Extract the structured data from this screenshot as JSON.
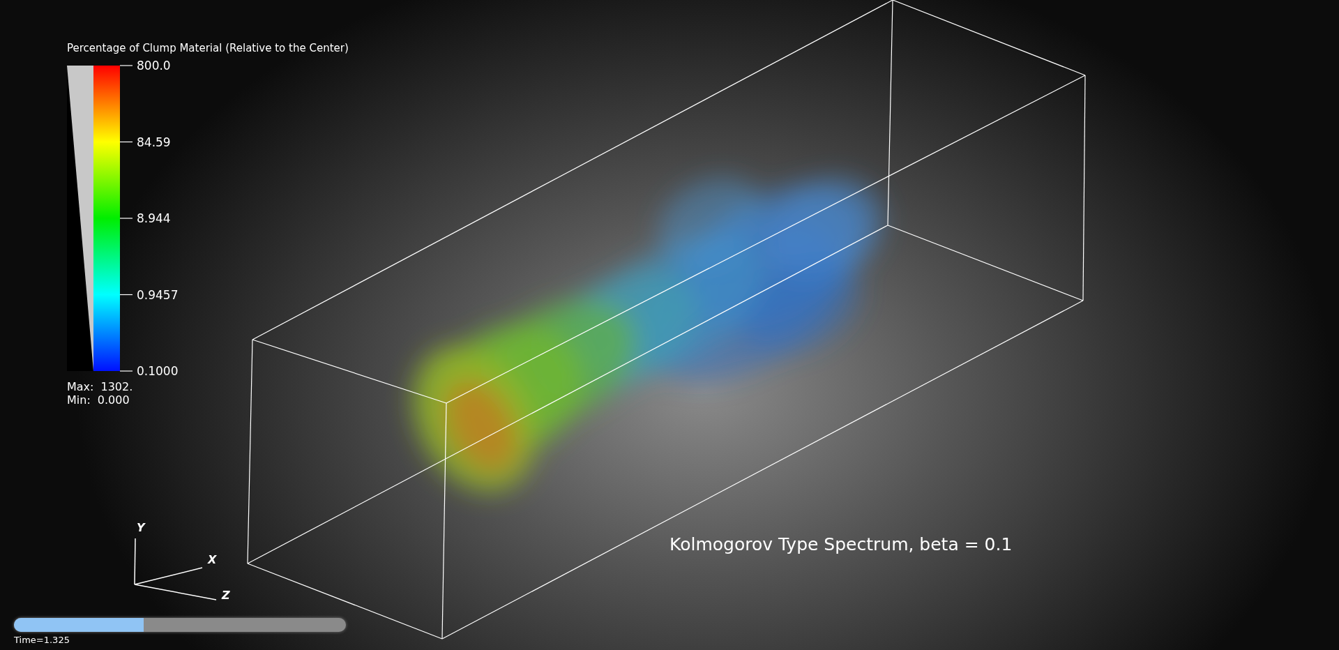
{
  "legend": {
    "title": "Percentage of Clump Material (Relative to the Center)",
    "ticks": [
      "800.0",
      "84.59",
      "8.944",
      "0.9457",
      "0.1000"
    ],
    "max_label": "Max:",
    "max_value": "1302.",
    "min_label": "Min:",
    "min_value": "0.000"
  },
  "annotation": "Kolmogorov Type Spectrum, beta = 0.1",
  "axes": {
    "y": "Y",
    "x": "X",
    "z": "Z"
  },
  "time_slider": {
    "level": 0.39,
    "label": "Time=1.325"
  }
}
